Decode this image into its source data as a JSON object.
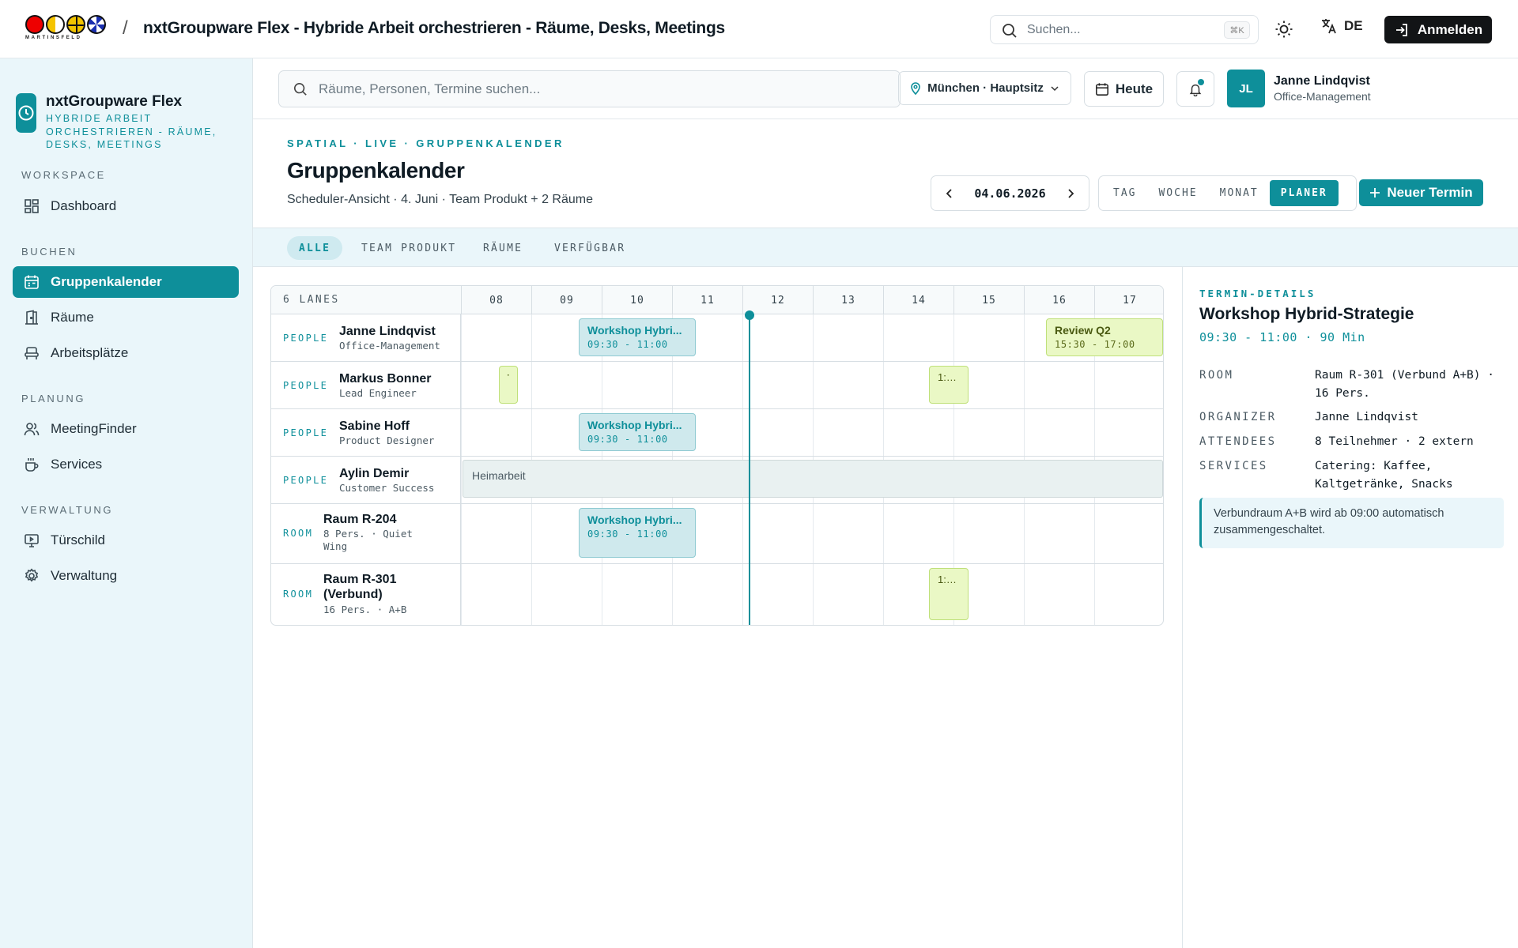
{
  "topbar": {
    "logo_caption": "MARTINSFELD",
    "title": "nxtGroupware Flex - Hybride Arbeit orchestrieren - Räume, Desks, Meetings",
    "search_placeholder": "Suchen...",
    "search_shortcut": "⌘K",
    "language": "DE",
    "login_label": "Anmelden"
  },
  "sidebar": {
    "brand_name": "nxtGroupware Flex",
    "brand_sub": "HYBRIDE ARBEIT ORCHESTRIEREN - RÄUME, DESKS, MEETINGS",
    "sections": [
      {
        "title": "WORKSPACE",
        "items": [
          {
            "label": "Dashboard",
            "icon": "dashboard-icon"
          }
        ]
      },
      {
        "title": "BUCHEN",
        "items": [
          {
            "label": "Gruppenkalender",
            "icon": "calendar-icon",
            "active": true
          },
          {
            "label": "Räume",
            "icon": "door-icon"
          },
          {
            "label": "Arbeitsplätze",
            "icon": "desk-icon"
          }
        ]
      },
      {
        "title": "PLANUNG",
        "items": [
          {
            "label": "MeetingFinder",
            "icon": "people-icon"
          },
          {
            "label": "Services",
            "icon": "coffee-icon"
          }
        ]
      },
      {
        "title": "VERWALTUNG",
        "items": [
          {
            "label": "Türschild",
            "icon": "display-icon"
          },
          {
            "label": "Verwaltung",
            "icon": "gear-icon"
          }
        ]
      }
    ]
  },
  "header": {
    "search_placeholder": "Räume, Personen, Termine suchen...",
    "location": "München · Hauptsitz",
    "today_label": "Heute",
    "user_initials": "JL",
    "user_name": "Janne Lindqvist",
    "user_role": "Office-Management"
  },
  "page": {
    "breadcrumb": "SPATIAL · LIVE · GRUPPENKALENDER",
    "title": "Gruppenkalender",
    "subtitle": "Scheduler-Ansicht · 4. Juni · Team Produkt + 2 Räume",
    "date": "04.06.2026",
    "views": [
      "TAG",
      "WOCHE",
      "MONAT",
      "PLANER"
    ],
    "active_view": "PLANER",
    "new_label": "Neuer Termin"
  },
  "filters": {
    "items": [
      "ALLE",
      "TEAM PRODUKT",
      "RÄUME",
      "VERFÜGBAR"
    ],
    "active": "ALLE"
  },
  "scheduler": {
    "lanes_header": "6 LANES",
    "hours": [
      "08",
      "09",
      "10",
      "11",
      "12",
      "13",
      "14",
      "15",
      "16",
      "17"
    ],
    "now_hour": 12.1,
    "lanes": [
      {
        "type": "PEOPLE",
        "name": "Janne Lindqvist",
        "sub": "Office-Management"
      },
      {
        "type": "PEOPLE",
        "name": "Markus Bonner",
        "sub": "Lead Engineer"
      },
      {
        "type": "PEOPLE",
        "name": "Sabine Hoff",
        "sub": "Product Designer"
      },
      {
        "type": "PEOPLE",
        "name": "Aylin Demir",
        "sub": "Customer Success"
      },
      {
        "type": "ROOM",
        "name": "Raum R-204",
        "sub": "8 Pers. · Quiet Wing"
      },
      {
        "type": "ROOM",
        "name": "Raum R-301 (Verbund)",
        "sub": "16 Pers. · A+B"
      }
    ],
    "events": {
      "workshop_title": "Workshop Hybri...",
      "workshop_time": "09:30 - 11:00",
      "review_title": "Review Q2",
      "review_time": "15:30 - 17:00",
      "oneonone_title": "1:1...",
      "short_title": "·",
      "home_label": "Heimarbeit"
    }
  },
  "details": {
    "caption": "TERMIN-DETAILS",
    "title": "Workshop Hybrid-Strategie",
    "time": "09:30 - 11:00 · 90 Min",
    "room_key": "ROOM",
    "room_val": "Raum R-301 (Verbund A+B) · 16 Pers.",
    "organizer_key": "ORGANIZER",
    "organizer_val": "Janne Lindqvist",
    "attendees_key": "ATTENDEES",
    "attendees_val": "8 Teilnehmer · 2 extern",
    "services_key": "SERVICES",
    "services_val": "Catering: Kaffee, Kaltgetränke, Snacks",
    "note": "Verbundraum A+B wird ab 09:00 automatisch zusammengeschaltet."
  },
  "colors": {
    "accent": "#0e8f9a",
    "lime": "#eaf8c5",
    "sidebar_bg": "#eaf6fa"
  }
}
